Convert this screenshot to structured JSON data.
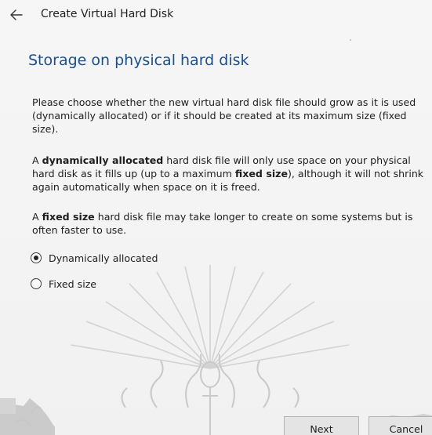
{
  "window": {
    "title": "Create Virtual Hard Disk"
  },
  "icons": {
    "back": "back-arrow-icon",
    "watermark": "emblem-watermark"
  },
  "main": {
    "heading": "Storage on physical hard disk",
    "para1": "Please choose whether the new virtual hard disk file should grow as it is used (dynamically allocated) or if it should be created at its maximum size (fixed size).",
    "para2": {
      "t1": "A ",
      "b1": "dynamically allocated",
      "t2": " hard disk file will only use space on your physical hard disk as it fills up (up to a maximum ",
      "b2": "fixed size",
      "t3": "), although it will not shrink again automatically when space on it is freed."
    },
    "para3": {
      "t1": "A ",
      "b1": "fixed size",
      "t2": " hard disk file may take longer to create on some systems but is often faster to use."
    },
    "options": [
      {
        "label": "Dynamically allocated",
        "selected": true
      },
      {
        "label": "Fixed size",
        "selected": false
      }
    ]
  },
  "buttons": {
    "next": "Next",
    "cancel": "Cancel"
  },
  "colors": {
    "heading": "#1c4f8c",
    "background": "#f2f2f2",
    "watermark": "#cfcfcf"
  }
}
